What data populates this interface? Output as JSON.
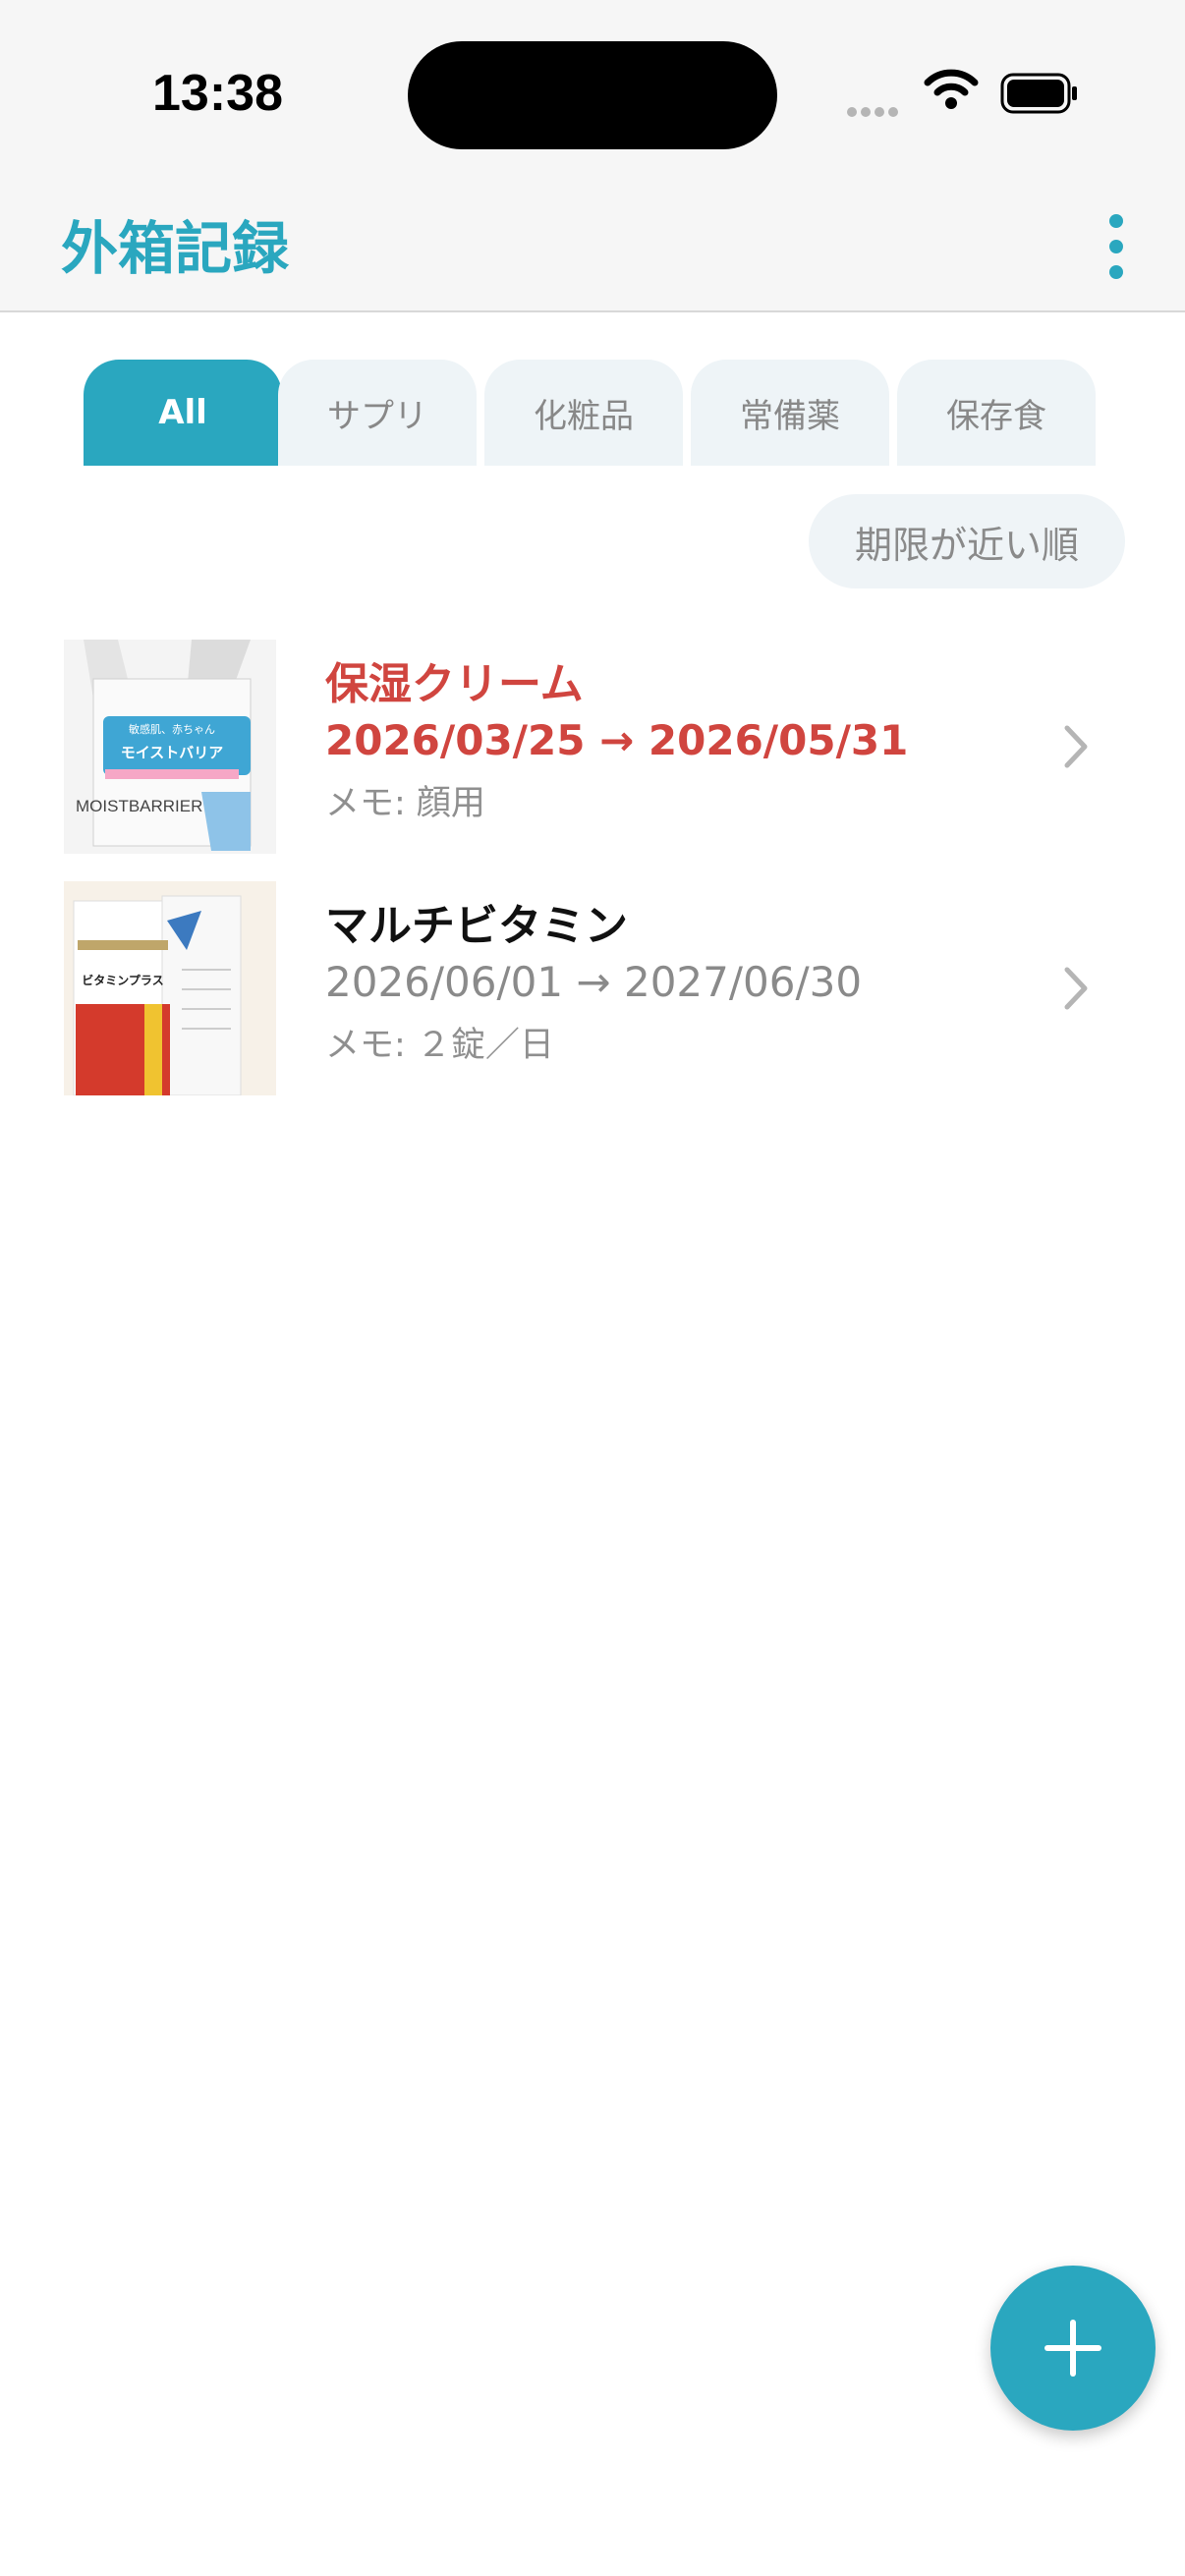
{
  "status_bar": {
    "time": "13:38"
  },
  "header": {
    "title": "外箱記録",
    "menu_icon": "more-vert-icon"
  },
  "tabs": [
    {
      "label": "All",
      "active": true
    },
    {
      "label": "サプリ",
      "active": false
    },
    {
      "label": "化粧品",
      "active": false
    },
    {
      "label": "常備薬",
      "active": false
    },
    {
      "label": "保存食",
      "active": false
    }
  ],
  "sort": {
    "label": "期限が近い順"
  },
  "items": [
    {
      "name": "保湿クリーム",
      "dates": "2026/03/25 → 2026/05/31",
      "memo": "メモ: 顔用",
      "status_color": "#d0453f",
      "thumbnail": {
        "text_1": "敏感肌、赤ちゃん",
        "text_2": "モイストバリア",
        "text_3": "MOISTBARRIER"
      }
    },
    {
      "name": "マルチビタミン",
      "dates": "2026/06/01 → 2027/06/30",
      "memo": "メモ: ２錠／日",
      "status_color": "#111111",
      "thumbnail": {
        "text_1": "ビタミンプラス"
      }
    }
  ],
  "colors": {
    "accent": "#2aa7bf",
    "expiring": "#d0453f",
    "tab_inactive_bg": "#eef4f7"
  },
  "fab": {
    "icon": "plus-icon"
  }
}
